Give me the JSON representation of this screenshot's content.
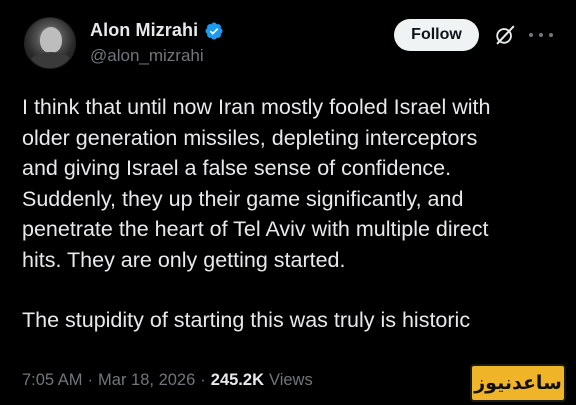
{
  "author": {
    "display_name": "Alon Mizrahi",
    "handle": "@alon_mizrahi",
    "verified_icon": "verified-badge-icon",
    "verified_color": "#1d9bf0"
  },
  "actions": {
    "follow_label": "Follow",
    "grok_icon": "grok-icon",
    "more_icon": "more-options-icon"
  },
  "tweet": {
    "lines_paragraph_1": [
      "I think that until now Iran mostly fooled Israel with",
      "older generation missiles, depleting interceptors",
      "and giving Israel a false sense of confidence.",
      "Suddenly, they up their game significantly, and",
      "penetrate the heart of Tel Aviv with multiple direct",
      "hits. They are only getting started."
    ],
    "line_paragraph_2": "The stupidity of starting this was truly is historic"
  },
  "meta": {
    "time": "7:05 AM",
    "separator_1": "·",
    "date": "Mar 18, 2026",
    "separator_2": "·",
    "views_count": "245.2K",
    "views_label": "Views"
  },
  "watermark": {
    "text": "ساعدنیوز",
    "background": "#f0b429"
  },
  "colors": {
    "background": "#000000",
    "text_primary": "#e7e9ea",
    "text_secondary": "#71767b",
    "follow_button_bg": "#eff3f4"
  }
}
